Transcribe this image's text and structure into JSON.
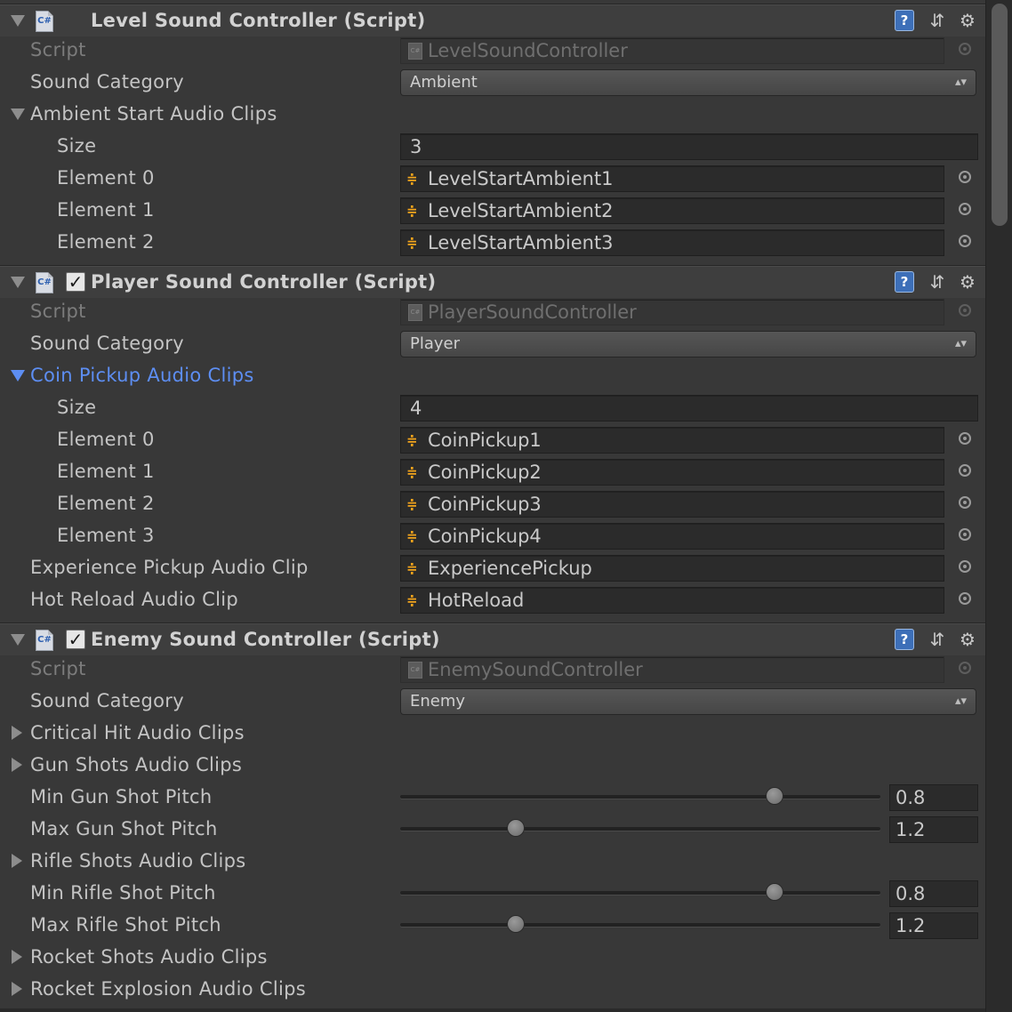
{
  "components": [
    {
      "title": "Level Sound Controller (Script)",
      "has_checkbox": false,
      "script_label": "Script",
      "script_value": "LevelSoundController",
      "category_label": "Sound Category",
      "category_value": "Ambient",
      "array_label": "Ambient Start Audio Clips",
      "size_label": "Size",
      "size_value": "3",
      "elements": [
        {
          "label": "Element 0",
          "value": "LevelStartAmbient1"
        },
        {
          "label": "Element 1",
          "value": "LevelStartAmbient2"
        },
        {
          "label": "Element 2",
          "value": "LevelStartAmbient3"
        }
      ]
    },
    {
      "title": "Player Sound Controller (Script)",
      "has_checkbox": true,
      "script_label": "Script",
      "script_value": "PlayerSoundController",
      "category_label": "Sound Category",
      "category_value": "Player",
      "array_label": "Coin Pickup Audio Clips",
      "size_label": "Size",
      "size_value": "4",
      "elements": [
        {
          "label": "Element 0",
          "value": "CoinPickup1"
        },
        {
          "label": "Element 1",
          "value": "CoinPickup2"
        },
        {
          "label": "Element 2",
          "value": "CoinPickup3"
        },
        {
          "label": "Element 3",
          "value": "CoinPickup4"
        }
      ],
      "extra_fields": [
        {
          "label": "Experience Pickup Audio Clip",
          "value": "ExperiencePickup"
        },
        {
          "label": "Hot Reload Audio Clip",
          "value": "HotReload"
        }
      ]
    },
    {
      "title": "Enemy Sound Controller (Script)",
      "has_checkbox": true,
      "script_label": "Script",
      "script_value": "EnemySoundController",
      "category_label": "Sound Category",
      "category_value": "Enemy",
      "rows": [
        {
          "type": "foldout",
          "label": "Critical Hit Audio Clips"
        },
        {
          "type": "foldout",
          "label": "Gun Shots Audio Clips"
        },
        {
          "type": "slider",
          "label": "Min Gun Shot Pitch",
          "value": "0.8",
          "fraction": 0.79
        },
        {
          "type": "slider",
          "label": "Max Gun Shot Pitch",
          "value": "1.2",
          "fraction": 0.23
        },
        {
          "type": "foldout",
          "label": "Rifle Shots Audio Clips"
        },
        {
          "type": "slider",
          "label": "Min Rifle Shot Pitch",
          "value": "0.8",
          "fraction": 0.79
        },
        {
          "type": "slider",
          "label": "Max Rifle Shot Pitch",
          "value": "1.2",
          "fraction": 0.23
        },
        {
          "type": "foldout",
          "label": "Rocket Shots Audio Clips"
        },
        {
          "type": "foldout",
          "label": "Rocket Explosion Audio Clips"
        }
      ]
    }
  ],
  "icons": {
    "help": "help-icon",
    "presets": "presets-icon",
    "settings": "gear-icon",
    "script_file": "cs-script-icon",
    "audio_clip": "audio-clip-icon",
    "object_picker": "object-picker-icon"
  },
  "colors": {
    "background": "#383838",
    "text": "#c4c4c4",
    "selected_label": "#5d8ef3",
    "audio_icon": "#f2a41c"
  }
}
